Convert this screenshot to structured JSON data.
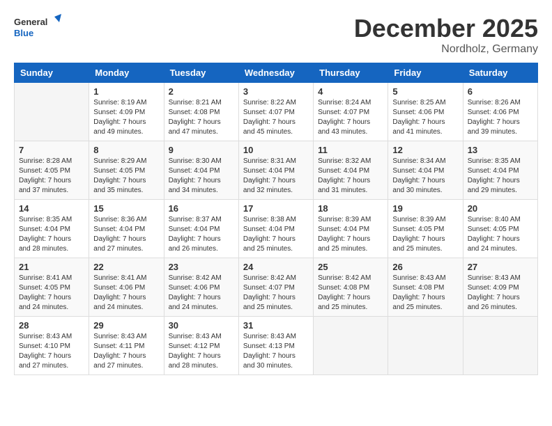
{
  "logo": {
    "line1": "General",
    "line2": "Blue"
  },
  "title": "December 2025",
  "location": "Nordholz, Germany",
  "weekdays": [
    "Sunday",
    "Monday",
    "Tuesday",
    "Wednesday",
    "Thursday",
    "Friday",
    "Saturday"
  ],
  "weeks": [
    [
      {
        "day": "",
        "sunrise": "",
        "sunset": "",
        "daylight": ""
      },
      {
        "day": "1",
        "sunrise": "Sunrise: 8:19 AM",
        "sunset": "Sunset: 4:09 PM",
        "daylight": "Daylight: 7 hours and 49 minutes."
      },
      {
        "day": "2",
        "sunrise": "Sunrise: 8:21 AM",
        "sunset": "Sunset: 4:08 PM",
        "daylight": "Daylight: 7 hours and 47 minutes."
      },
      {
        "day": "3",
        "sunrise": "Sunrise: 8:22 AM",
        "sunset": "Sunset: 4:07 PM",
        "daylight": "Daylight: 7 hours and 45 minutes."
      },
      {
        "day": "4",
        "sunrise": "Sunrise: 8:24 AM",
        "sunset": "Sunset: 4:07 PM",
        "daylight": "Daylight: 7 hours and 43 minutes."
      },
      {
        "day": "5",
        "sunrise": "Sunrise: 8:25 AM",
        "sunset": "Sunset: 4:06 PM",
        "daylight": "Daylight: 7 hours and 41 minutes."
      },
      {
        "day": "6",
        "sunrise": "Sunrise: 8:26 AM",
        "sunset": "Sunset: 4:06 PM",
        "daylight": "Daylight: 7 hours and 39 minutes."
      }
    ],
    [
      {
        "day": "7",
        "sunrise": "Sunrise: 8:28 AM",
        "sunset": "Sunset: 4:05 PM",
        "daylight": "Daylight: 7 hours and 37 minutes."
      },
      {
        "day": "8",
        "sunrise": "Sunrise: 8:29 AM",
        "sunset": "Sunset: 4:05 PM",
        "daylight": "Daylight: 7 hours and 35 minutes."
      },
      {
        "day": "9",
        "sunrise": "Sunrise: 8:30 AM",
        "sunset": "Sunset: 4:04 PM",
        "daylight": "Daylight: 7 hours and 34 minutes."
      },
      {
        "day": "10",
        "sunrise": "Sunrise: 8:31 AM",
        "sunset": "Sunset: 4:04 PM",
        "daylight": "Daylight: 7 hours and 32 minutes."
      },
      {
        "day": "11",
        "sunrise": "Sunrise: 8:32 AM",
        "sunset": "Sunset: 4:04 PM",
        "daylight": "Daylight: 7 hours and 31 minutes."
      },
      {
        "day": "12",
        "sunrise": "Sunrise: 8:34 AM",
        "sunset": "Sunset: 4:04 PM",
        "daylight": "Daylight: 7 hours and 30 minutes."
      },
      {
        "day": "13",
        "sunrise": "Sunrise: 8:35 AM",
        "sunset": "Sunset: 4:04 PM",
        "daylight": "Daylight: 7 hours and 29 minutes."
      }
    ],
    [
      {
        "day": "14",
        "sunrise": "Sunrise: 8:35 AM",
        "sunset": "Sunset: 4:04 PM",
        "daylight": "Daylight: 7 hours and 28 minutes."
      },
      {
        "day": "15",
        "sunrise": "Sunrise: 8:36 AM",
        "sunset": "Sunset: 4:04 PM",
        "daylight": "Daylight: 7 hours and 27 minutes."
      },
      {
        "day": "16",
        "sunrise": "Sunrise: 8:37 AM",
        "sunset": "Sunset: 4:04 PM",
        "daylight": "Daylight: 7 hours and 26 minutes."
      },
      {
        "day": "17",
        "sunrise": "Sunrise: 8:38 AM",
        "sunset": "Sunset: 4:04 PM",
        "daylight": "Daylight: 7 hours and 25 minutes."
      },
      {
        "day": "18",
        "sunrise": "Sunrise: 8:39 AM",
        "sunset": "Sunset: 4:04 PM",
        "daylight": "Daylight: 7 hours and 25 minutes."
      },
      {
        "day": "19",
        "sunrise": "Sunrise: 8:39 AM",
        "sunset": "Sunset: 4:05 PM",
        "daylight": "Daylight: 7 hours and 25 minutes."
      },
      {
        "day": "20",
        "sunrise": "Sunrise: 8:40 AM",
        "sunset": "Sunset: 4:05 PM",
        "daylight": "Daylight: 7 hours and 24 minutes."
      }
    ],
    [
      {
        "day": "21",
        "sunrise": "Sunrise: 8:41 AM",
        "sunset": "Sunset: 4:05 PM",
        "daylight": "Daylight: 7 hours and 24 minutes."
      },
      {
        "day": "22",
        "sunrise": "Sunrise: 8:41 AM",
        "sunset": "Sunset: 4:06 PM",
        "daylight": "Daylight: 7 hours and 24 minutes."
      },
      {
        "day": "23",
        "sunrise": "Sunrise: 8:42 AM",
        "sunset": "Sunset: 4:06 PM",
        "daylight": "Daylight: 7 hours and 24 minutes."
      },
      {
        "day": "24",
        "sunrise": "Sunrise: 8:42 AM",
        "sunset": "Sunset: 4:07 PM",
        "daylight": "Daylight: 7 hours and 25 minutes."
      },
      {
        "day": "25",
        "sunrise": "Sunrise: 8:42 AM",
        "sunset": "Sunset: 4:08 PM",
        "daylight": "Daylight: 7 hours and 25 minutes."
      },
      {
        "day": "26",
        "sunrise": "Sunrise: 8:43 AM",
        "sunset": "Sunset: 4:08 PM",
        "daylight": "Daylight: 7 hours and 25 minutes."
      },
      {
        "day": "27",
        "sunrise": "Sunrise: 8:43 AM",
        "sunset": "Sunset: 4:09 PM",
        "daylight": "Daylight: 7 hours and 26 minutes."
      }
    ],
    [
      {
        "day": "28",
        "sunrise": "Sunrise: 8:43 AM",
        "sunset": "Sunset: 4:10 PM",
        "daylight": "Daylight: 7 hours and 27 minutes."
      },
      {
        "day": "29",
        "sunrise": "Sunrise: 8:43 AM",
        "sunset": "Sunset: 4:11 PM",
        "daylight": "Daylight: 7 hours and 27 minutes."
      },
      {
        "day": "30",
        "sunrise": "Sunrise: 8:43 AM",
        "sunset": "Sunset: 4:12 PM",
        "daylight": "Daylight: 7 hours and 28 minutes."
      },
      {
        "day": "31",
        "sunrise": "Sunrise: 8:43 AM",
        "sunset": "Sunset: 4:13 PM",
        "daylight": "Daylight: 7 hours and 30 minutes."
      },
      {
        "day": "",
        "sunrise": "",
        "sunset": "",
        "daylight": ""
      },
      {
        "day": "",
        "sunrise": "",
        "sunset": "",
        "daylight": ""
      },
      {
        "day": "",
        "sunrise": "",
        "sunset": "",
        "daylight": ""
      }
    ]
  ]
}
